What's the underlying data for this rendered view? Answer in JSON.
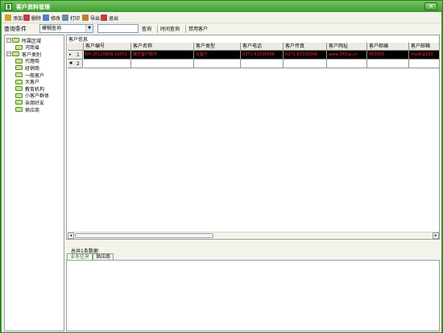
{
  "window": {
    "title": "客户资料管理",
    "close_symbol": "×"
  },
  "toolbar": [
    {
      "label": "添加",
      "icon": "add-icon",
      "color": "#d0a030"
    },
    {
      "label": "删除",
      "icon": "delete-icon",
      "color": "#c04040"
    },
    {
      "label": "修改",
      "icon": "edit-icon",
      "color": "#4f7fc0"
    },
    {
      "label": "打印",
      "icon": "print-icon",
      "color": "#6a8aa8"
    },
    {
      "label": "导出",
      "icon": "export-icon",
      "color": "#c08030"
    },
    {
      "label": "退出",
      "icon": "exit-icon",
      "color": "#c04040"
    }
  ],
  "query": {
    "label": "查询条件",
    "mode_value": "模糊查询",
    "search_value": "",
    "buttons": [
      "查询",
      "时间查询",
      "禁用客户"
    ]
  },
  "tree": [
    {
      "label": "所属区域",
      "level": 0,
      "toggle": "−"
    },
    {
      "label": "河南省",
      "level": 1
    },
    {
      "label": "客户类别",
      "level": 0,
      "toggle": "−"
    },
    {
      "label": "代理商",
      "level": 1
    },
    {
      "label": "经销商",
      "level": 1
    },
    {
      "label": "一般客户",
      "level": 1
    },
    {
      "label": "大客户",
      "level": 1
    },
    {
      "label": "教育机构",
      "level": 1
    },
    {
      "label": "小客户群体",
      "level": 1
    },
    {
      "label": "亲朋好友",
      "level": 1
    },
    {
      "label": "供应商",
      "level": 1
    }
  ],
  "grid": {
    "panel_title": "客户信息",
    "columns": [
      "客户编号",
      "客户名称",
      "客户类型",
      "客户电话",
      "客户传真",
      "客户网址",
      "客户邮编",
      "客户邮箱"
    ],
    "rows": [
      {
        "marker": "▸",
        "num": "1",
        "selected": true,
        "cells": [
          "KH-20120608-10001",
          "瑞方客户软件",
          "大客户",
          "0371-63335068",
          "0371-63335068",
          "www.365rp.cn",
          "450003",
          "rfsoft@163"
        ]
      },
      {
        "marker": "✱",
        "num": "2",
        "selected": false,
        "cells": [
          "",
          "",
          "",
          "",
          "",
          "",
          "",
          ""
        ]
      }
    ],
    "row_text_color": "#ff2a2a",
    "selected_bg": "#000000"
  },
  "scroll": {
    "left": "◂",
    "right": "▸"
  },
  "status": "总共1条数据",
  "tabs": [
    {
      "label": "业务往来",
      "active": true
    },
    {
      "label": "供应商",
      "active": false
    }
  ]
}
